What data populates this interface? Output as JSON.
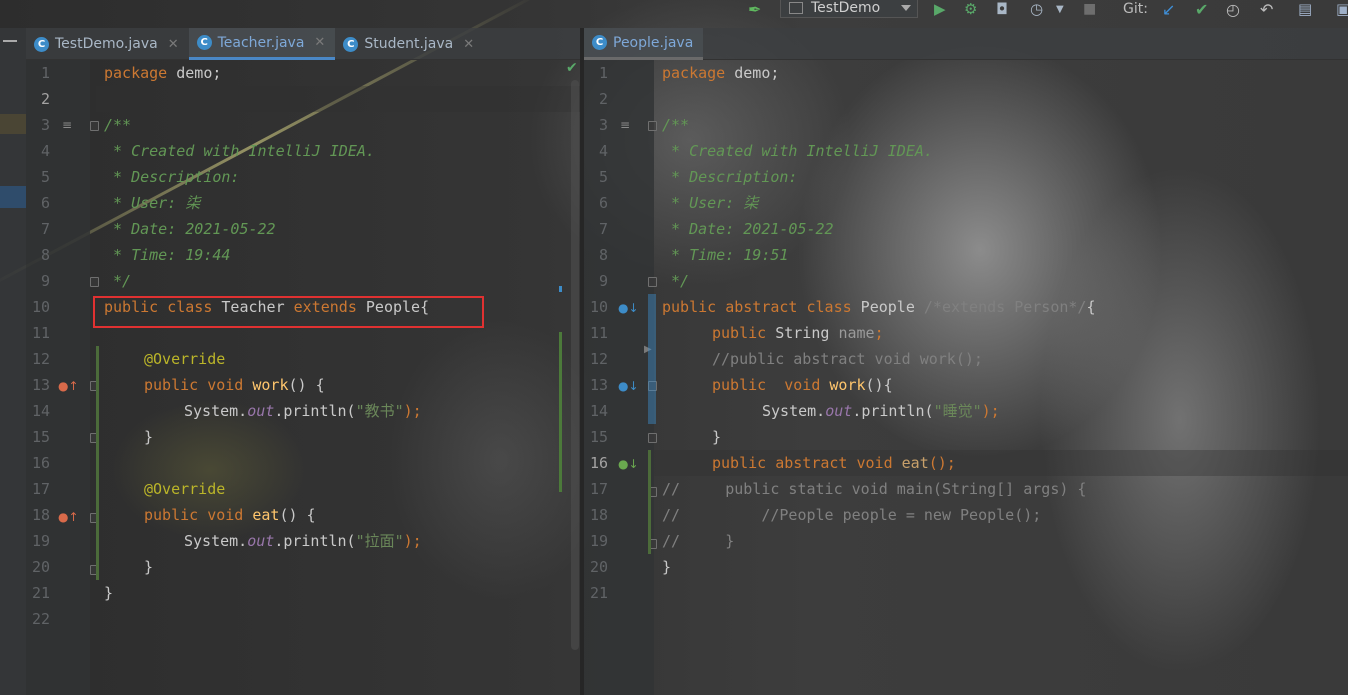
{
  "toolbar": {
    "run_config": "TestDemo",
    "git_label": "Git:"
  },
  "left_tabs": [
    {
      "label": "TestDemo.java",
      "icon": "java-class-run-icon",
      "active": false
    },
    {
      "label": "Teacher.java",
      "icon": "java-class-icon",
      "active": true
    },
    {
      "label": "Student.java",
      "icon": "java-class-icon",
      "active": false
    }
  ],
  "right_tabs": [
    {
      "label": "People.java",
      "icon": "java-class-icon",
      "active": true
    }
  ],
  "left_editor": {
    "lines": [
      "1",
      "2",
      "3",
      "4",
      "5",
      "6",
      "7",
      "8",
      "9",
      "10",
      "11",
      "12",
      "13",
      "14",
      "15",
      "16",
      "17",
      "18",
      "19",
      "20",
      "21",
      "22"
    ],
    "current_line": "2",
    "code": {
      "l1a": "package",
      "l1b": " demo;",
      "l3": "/**",
      "l4": " * Created with IntelliJ IDEA.",
      "l5": " * Description:",
      "l6": " * User: 柒",
      "l7": " * Date: 2021-05-22",
      "l8": " * Time: 19:44",
      "l9": " */",
      "l10a": "public class",
      "l10b": " Teacher ",
      "l10c": "extends",
      "l10d": " People{",
      "l12": "@Override",
      "l13a": "public void",
      "l13b": " work",
      "l13c": "() {",
      "l14a": "System.",
      "l14b": "out",
      "l14c": ".println(",
      "l14d": "\"教书\"",
      "l14e": ");",
      "l15": "}",
      "l17": "@Override",
      "l18a": "public void",
      "l18b": " eat",
      "l18c": "() {",
      "l19a": "System.",
      "l19b": "out",
      "l19c": ".println(",
      "l19d": "\"拉面\"",
      "l19e": ");",
      "l20": "}",
      "l21": "}"
    }
  },
  "right_editor": {
    "lines": [
      "1",
      "2",
      "3",
      "4",
      "5",
      "6",
      "7",
      "8",
      "9",
      "10",
      "11",
      "12",
      "13",
      "14",
      "15",
      "16",
      "17",
      "18",
      "19",
      "20",
      "21"
    ],
    "current_line": "16",
    "code": {
      "l1a": "package",
      "l1b": " demo;",
      "l3": "/**",
      "l4": " * Created with IntelliJ IDEA.",
      "l5": " * Description:",
      "l6": " * User: 柒",
      "l7": " * Date: 2021-05-22",
      "l8": " * Time: 19:51",
      "l9": " */",
      "l10a": "public abstract class",
      "l10b": " People ",
      "l10c": "/*extends Person*/",
      "l10d": "{",
      "l11a": "public",
      "l11b": " String ",
      "l11c": "name",
      "l11d": ";",
      "l12": "//public abstract void work();",
      "l13a": "public  void",
      "l13b": " work",
      "l13c": "(){",
      "l14a": "System.",
      "l14b": "out",
      "l14c": ".println(",
      "l14d": "\"睡觉\"",
      "l14e": ");",
      "l15": "}",
      "l16a": "public abstract void",
      "l16b": " eat",
      "l16c": "();",
      "l17": "//     public static void main(String[] args) {",
      "l18": "//         //People people = new People();",
      "l19": "//     }",
      "l20": "}"
    }
  },
  "colors": {
    "keyword": "#cc7832",
    "comment_doc": "#629755",
    "string": "#6a8759",
    "annotation": "#bbb529",
    "method": "#ffc66d",
    "static_field": "#9876aa",
    "highlight_box": "#e03131",
    "tab_accent": "#4a88c7"
  }
}
